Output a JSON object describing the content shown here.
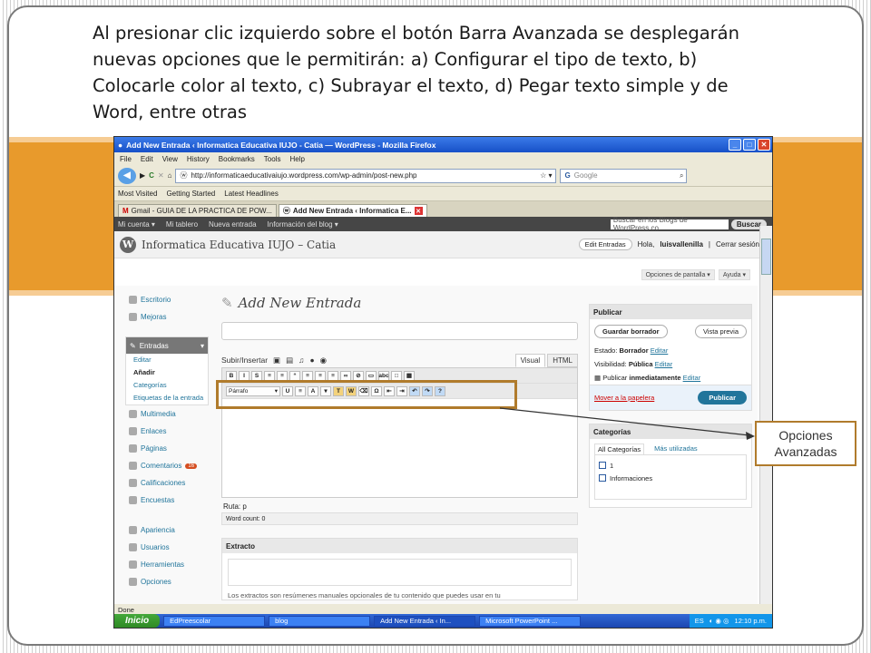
{
  "caption": "Al presionar clic izquierdo sobre el botón Barra Avanzada se desplegarán nuevas opciones que le permitirán: a) Configurar el tipo de texto, b) Colocarle color al texto, c) Subrayar el texto, d) Pegar texto simple y de Word, entre otras",
  "callout": "Opciones Avanzadas",
  "browser": {
    "title": "Add New Entrada ‹ Informatica Educativa IUJO - Catia — WordPress - Mozilla Firefox",
    "menu": [
      "File",
      "Edit",
      "View",
      "History",
      "Bookmarks",
      "Tools",
      "Help"
    ],
    "url": "http://informaticaeducativaiujo.wordpress.com/wp-admin/post-new.php",
    "search_placeholder": "Google",
    "bookmarks": [
      "Most Visited",
      "Getting Started",
      "Latest Headlines"
    ],
    "tabs": [
      "Gmail - GUIA DE LA PRACTICA DE POW...",
      "Add New Entrada ‹ Informatica E..."
    ],
    "status": "Done"
  },
  "wp": {
    "adminbar": [
      "Mi cuenta ▾",
      "Mi tablero",
      "Nueva entrada",
      "Información del blog ▾"
    ],
    "search_placeholder": "Buscar en los Blogs de WordPress.co",
    "search_button": "Buscar",
    "site_title": "Informatica Educativa IUJO – Catia",
    "edit_button": "Edit Entradas",
    "greeting_prefix": "Hola,",
    "username": "luisvallenilla",
    "logout": "Cerrar sesión",
    "screen_options": "Opciones de pantalla ▾",
    "help": "Ayuda ▾",
    "page_title": "Add New Entrada",
    "upload_label": "Subir/Insertar",
    "tab_visual": "Visual",
    "tab_html": "HTML",
    "format_select": "Párrafo",
    "path": "Ruta: p",
    "word_count": "Word count: 0",
    "excerpt_title": "Extracto",
    "excerpt_note": "Los extractos son resúmenes manuales opcionales de tu contenido que puedes usar en tu",
    "sidebar": {
      "top": [
        "Escritorio",
        "Mejoras"
      ],
      "entradas": "Entradas",
      "entradas_sub": [
        "Editar",
        "Añadir",
        "Categorías",
        "Etiquetas de la entrada"
      ],
      "middle": [
        "Multimedia",
        "Enlaces",
        "Páginas",
        "Comentarios",
        "Calificaciones",
        "Encuestas"
      ],
      "comments_badge": "16",
      "bottom": [
        "Apariencia",
        "Usuarios",
        "Herramientas",
        "Opciones"
      ]
    },
    "publish": {
      "title": "Publicar",
      "save_draft": "Guardar borrador",
      "preview": "Vista previa",
      "status_label": "Estado:",
      "status_value": "Borrador",
      "visibility_label": "Visibilidad:",
      "visibility_value": "Pública",
      "publish_label": "Publicar",
      "publish_value": "inmediatamente",
      "edit_link": "Editar",
      "trash": "Mover a la papelera",
      "publish_button": "Publicar"
    },
    "categories": {
      "title": "Categorías",
      "tab_all": "All Categorías",
      "tab_used": "Más utilizadas",
      "items": [
        "1",
        "Informaciones"
      ]
    }
  },
  "taskbar": {
    "start": "Inicio",
    "tasks": [
      "EdPreescolar",
      "blog",
      "Add New Entrada ‹ In...",
      "Microsoft PowerPoint ..."
    ],
    "lang": "ES",
    "time": "12:10 p.m."
  }
}
